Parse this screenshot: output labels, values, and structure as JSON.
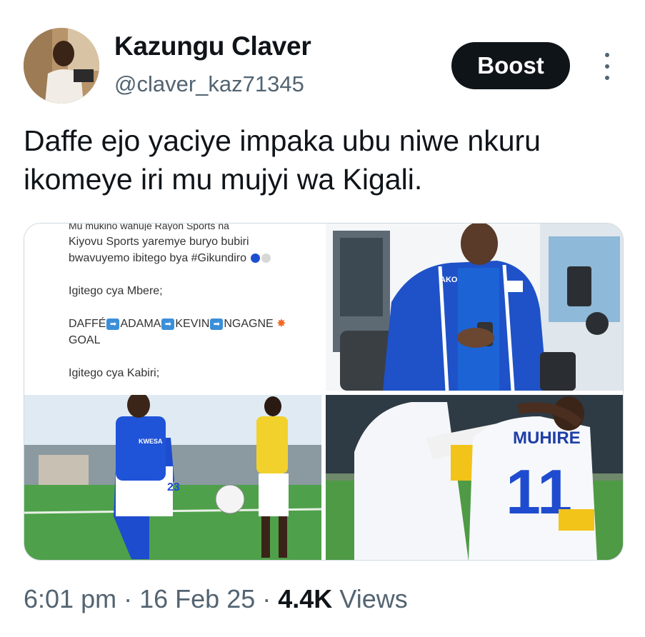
{
  "author": {
    "name": "Kazungu Claver",
    "handle": "@claver_kaz71345"
  },
  "actions": {
    "boost_label": "Boost"
  },
  "tweet": {
    "text": "Daffe ejo yaciye impaka ubu niwe nkuru ikomeye iri mu mujyi wa Kigali."
  },
  "media": {
    "screenshot_text": {
      "cut_line": "Mu mukino wahuje Rayon Sports na",
      "line1": "Kiyovu Sports yaremye buryo bubiri",
      "line2": "bwavuyemo ibitego bya #Gikundiro",
      "heading1": "Igitego cya Mbere;",
      "names": [
        "DAFFÉ",
        "ADAMA",
        "KEVIN",
        "NGAGNE"
      ],
      "goal": "GOAL",
      "heading2": "Igitego cya Kabiri;"
    },
    "photo_texts": {
      "jacket_brand": "AKO",
      "bib_brand": "KWESA",
      "shirt_number_left": "23",
      "jersey_name": "MUHIRE",
      "jersey_number": "11"
    }
  },
  "meta": {
    "time": "6:01 pm",
    "sep": "·",
    "date": "16 Feb 25",
    "views_count": "4.4K",
    "views_label": "Views"
  },
  "colors": {
    "text": "#0f1419",
    "muted": "#536471",
    "rayon_blue": "#1b46c9",
    "button_bg": "#0f1419"
  }
}
